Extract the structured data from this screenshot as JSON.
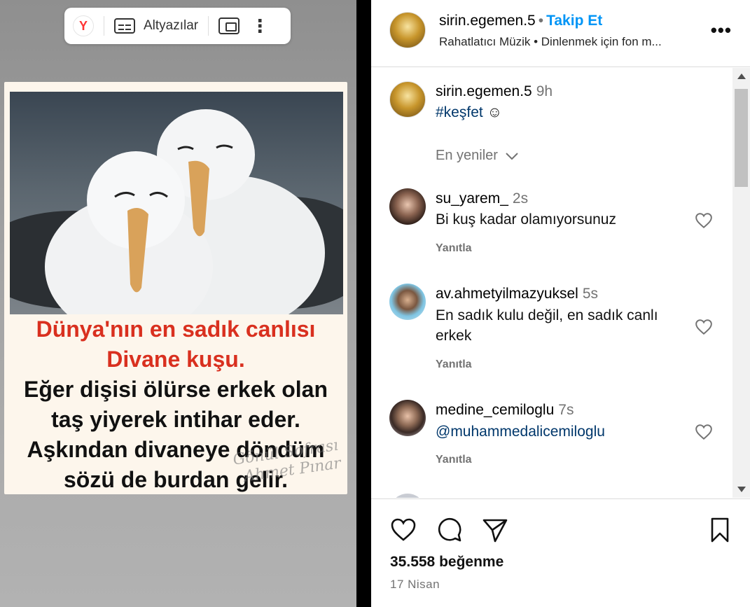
{
  "player": {
    "browser_icon": "yandex-icon",
    "subtitles_label": "Altyazılar",
    "pip_icon": "picture-in-picture-icon",
    "more_icon": "more-vertical-icon"
  },
  "media": {
    "lines": [
      "Dünya'nın en sadık canlısı",
      "Divane kuşu.",
      "Eğer dişisi ölürse erkek olan",
      "taş yiyerek intihar eder.",
      "Aşkından divaneye döndüm",
      "sözü de burdan gelir."
    ],
    "watermark": [
      "Gönül Sofrası",
      "Ahmet Pınar"
    ]
  },
  "header": {
    "username": "sirin.egemen.5",
    "separator": "•",
    "follow": "Takip Et",
    "audio": "Rahatlatıcı Müzik • Dinlenmek için fon m...",
    "more": "•••"
  },
  "caption": {
    "username": "sirin.egemen.5",
    "time": "9h",
    "hashtag": "#keşfet",
    "emoji": "☺"
  },
  "sort_label": "En yeniler",
  "comments": [
    {
      "username": "su_yarem_",
      "time": "2s",
      "text": "Bi kuş kadar olamıyorsunuz",
      "reply": "Yanıtla"
    },
    {
      "username": "av.ahmetyilmazyuksel",
      "time": "5s",
      "text": "En sadık kulu değil, en sadık canlı erkek",
      "reply": "Yanıtla"
    },
    {
      "username": "medine_cemiloglu",
      "time": "7s",
      "text": "@muhammedalicemiloglu",
      "reply": "Yanıtla"
    }
  ],
  "actions": {
    "likes": "35.558 beğenme",
    "date": "17 Nisan"
  },
  "colors": {
    "accent": "#0095f6",
    "link": "#00376b",
    "card_red": "#d9301f"
  }
}
